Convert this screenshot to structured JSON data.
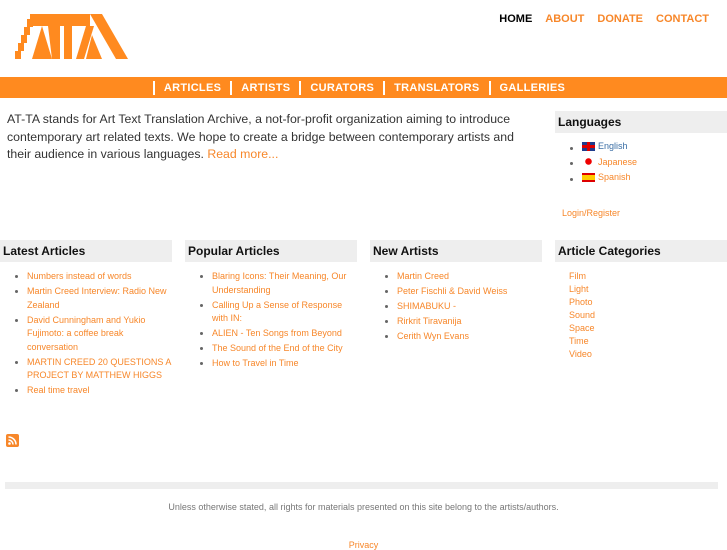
{
  "logo_text": "ATTA",
  "topnav": [
    {
      "label": "HOME",
      "active": true
    },
    {
      "label": "ABOUT"
    },
    {
      "label": "DONATE"
    },
    {
      "label": "CONTACT"
    }
  ],
  "mainnav": [
    "ARTICLES",
    "ARTISTS",
    "CURATORS",
    "TRANSLATORS",
    "GALLERIES"
  ],
  "intro": {
    "text": "AT-TA stands for Art Text Translation Archive, a not-for-profit organization aiming to introduce contemporary art related texts. We hope to create a bridge between contemporary artists and their audience in various languages. ",
    "read_more": "Read more..."
  },
  "languages": {
    "title": "Languages",
    "items": [
      "English",
      "Japanese",
      "Spanish"
    ]
  },
  "login": "Login/Register",
  "latest": {
    "title": "Latest Articles",
    "items": [
      "Numbers instead of words",
      "Martin Creed Interview: Radio New Zealand",
      "David Cunningham and Yukio Fujimoto: a coffee break conversation",
      "MARTIN CREED 20 QUESTIONS A PROJECT BY MATTHEW HIGGS",
      "Real time travel"
    ]
  },
  "popular": {
    "title": "Popular Articles",
    "items": [
      "Blaring Icons: Their Meaning, Our Understanding",
      "Calling Up a Sense of Response with IN:",
      "ALIEN - Ten Songs from Beyond",
      "The Sound of the End of the City",
      "How to Travel in Time"
    ]
  },
  "artists": {
    "title": "New Artists",
    "items": [
      "Martin Creed",
      "Peter Fischli & David Weiss",
      "SHIMABUKU -",
      "Rirkrit Tiravanija",
      "Cerith Wyn Evans"
    ]
  },
  "categories": {
    "title": "Article Categories",
    "items": [
      "Film",
      "Light",
      "Photo",
      "Sound",
      "Space",
      "Time",
      "Video"
    ]
  },
  "footer": {
    "copyright": "Unless otherwise stated, all rights for materials presented on this site belong to the artists/authors.",
    "privacy": "Privacy"
  }
}
